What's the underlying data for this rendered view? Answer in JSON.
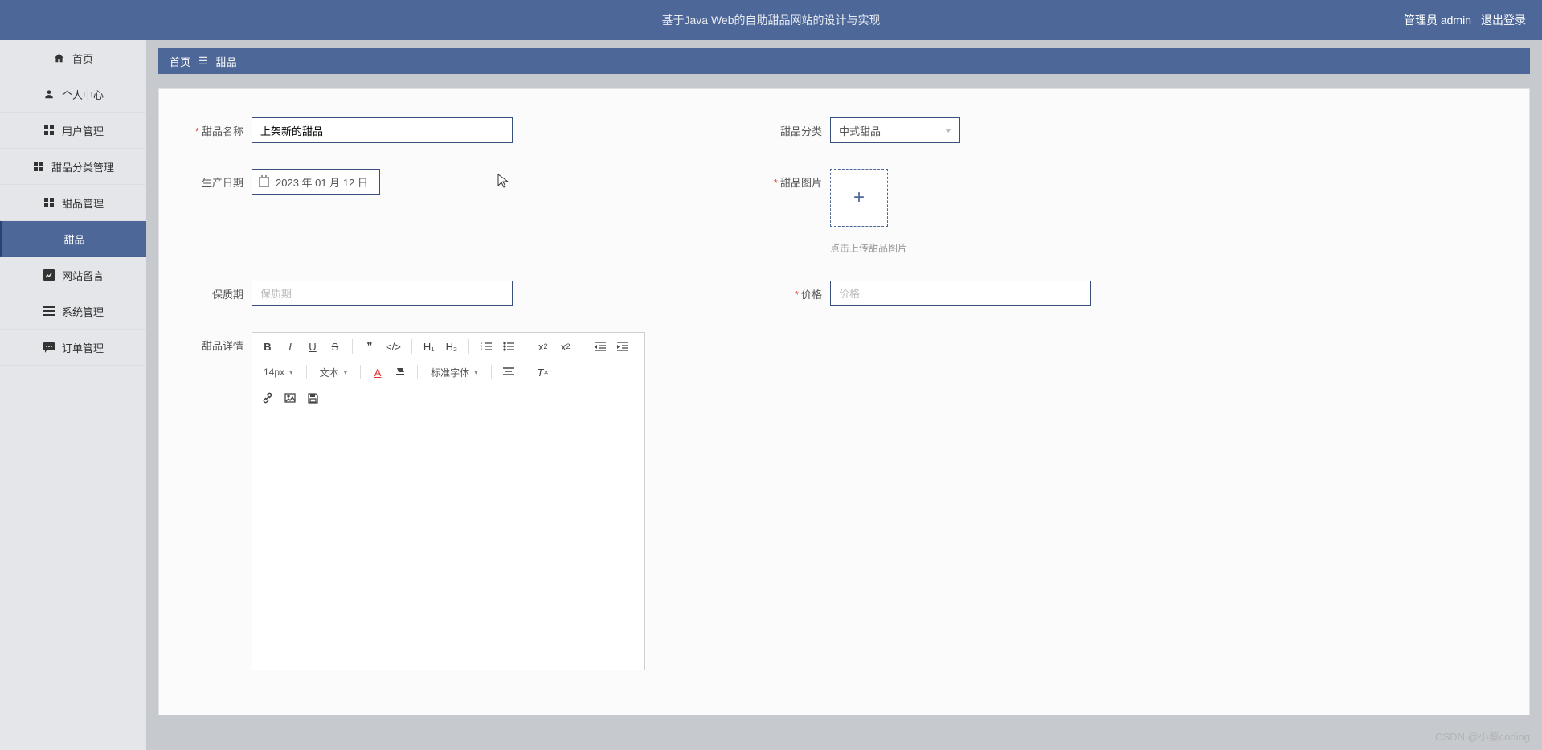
{
  "header": {
    "title": "基于Java Web的自助甜品网站的设计与实现",
    "role_label": "管理员 admin",
    "logout": "退出登录"
  },
  "sidebar": {
    "items": [
      {
        "label": "首页",
        "icon": "home"
      },
      {
        "label": "个人中心",
        "icon": "person"
      },
      {
        "label": "用户管理",
        "icon": "grid"
      },
      {
        "label": "甜品分类管理",
        "icon": "grid"
      },
      {
        "label": "甜品管理",
        "icon": "grid"
      },
      {
        "label": "甜品",
        "icon": ""
      },
      {
        "label": "网站留言",
        "icon": "chart"
      },
      {
        "label": "系统管理",
        "icon": "menu"
      },
      {
        "label": "订单管理",
        "icon": "chat"
      }
    ]
  },
  "breadcrumb": {
    "home": "首页",
    "current": "甜品"
  },
  "form": {
    "name_label": "甜品名称",
    "name_value": "上架新的甜品",
    "category_label": "甜品分类",
    "category_value": "中式甜品",
    "date_label": "生产日期",
    "date_value": "2023 年 01 月 12 日",
    "image_label": "甜品图片",
    "image_hint": "点击上传甜品图片",
    "shelf_label": "保质期",
    "shelf_placeholder": "保质期",
    "price_label": "价格",
    "price_placeholder": "价格",
    "detail_label": "甜品详情"
  },
  "editor": {
    "fontsize": "14px",
    "texttype": "文本",
    "fontfamily": "标准字体"
  },
  "watermark": "CSDN @小蔡coding"
}
